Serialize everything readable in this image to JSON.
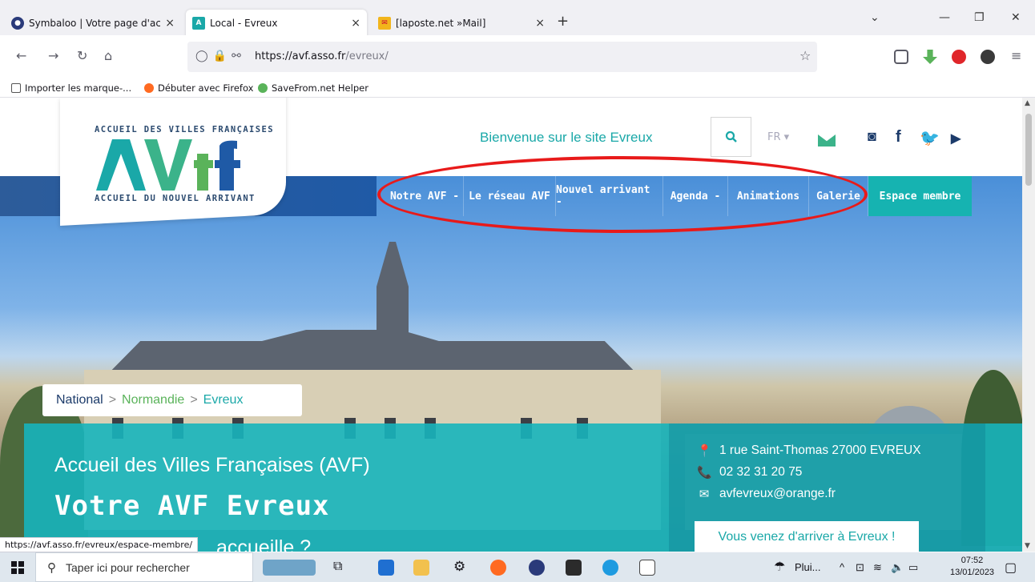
{
  "browser": {
    "tabs": [
      {
        "title": "Symbaloo | Votre page d'accueil",
        "active": false
      },
      {
        "title": "Local - Evreux",
        "active": true
      },
      {
        "title": "[laposte.net »Mail]",
        "active": false
      }
    ],
    "url_domain": "https://avf.asso.fr",
    "url_path": "/evreux/",
    "bookmarks": [
      "Importer les marque-...",
      "Débuter avec Firefox",
      "SaveFrom.net Helper"
    ],
    "status_url": "https://avf.asso.fr/evreux/espace-membre/"
  },
  "site": {
    "logo_top": "ACCUEIL DES VILLES FRANÇAISES",
    "logo_bottom": "ACCUEIL DU NOUVEL ARRIVANT",
    "welcome": "Bienvenue sur le site Evreux",
    "lang": "FR ▾",
    "nav": [
      "Notre AVF -",
      "Le réseau AVF",
      "Nouvel arrivant -",
      "Agenda -",
      "Animations",
      "Galerie",
      "Espace membre"
    ],
    "breadcrumb": {
      "national": "National",
      "sep": ">",
      "region": "Normandie",
      "city": "Evreux"
    },
    "subtitle": "Accueil des Villes Françaises (AVF)",
    "title": "Votre AVF Evreux",
    "next_line": "accueille ?",
    "contact": {
      "address": "1 rue Saint-Thomas 27000 EVREUX",
      "phone": "02 32 31 20 75",
      "email": "avfevreux@orange.fr"
    },
    "arrive_button": "Vous venez d'arriver à Evreux !"
  },
  "taskbar": {
    "search_placeholder": "Taper ici pour rechercher",
    "weather": "Plui...",
    "time": "07:52",
    "date": "13/01/2023"
  },
  "colors": {
    "nav_blue": "#1f5aa6",
    "teal": "#17b4bb",
    "highlight_red": "#e81a1a"
  }
}
